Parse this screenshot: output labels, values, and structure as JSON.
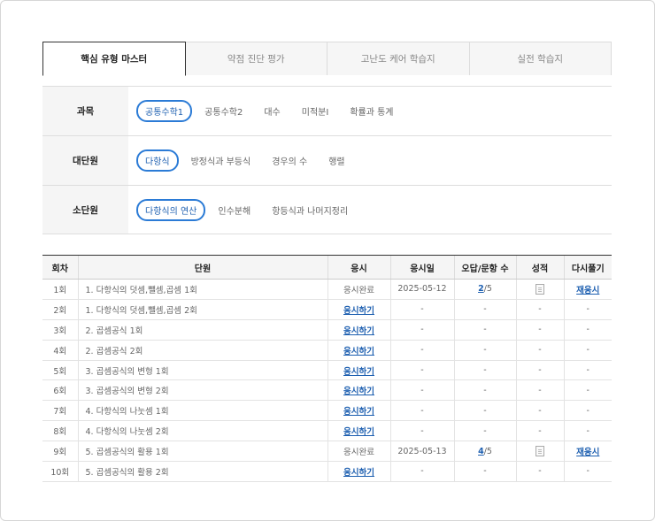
{
  "tabs": [
    {
      "label": "핵심 유형 마스터",
      "active": true
    },
    {
      "label": "약점 진단 평가",
      "active": false
    },
    {
      "label": "고난도 케어 학습지",
      "active": false
    },
    {
      "label": "실전 학습지",
      "active": false
    }
  ],
  "filters": {
    "subject": {
      "label": "과목",
      "options": [
        "공통수학1",
        "공통수학2",
        "대수",
        "미적분Ⅰ",
        "확률과 통계"
      ],
      "selected": "공통수학1"
    },
    "major_unit": {
      "label": "대단원",
      "options": [
        "다항식",
        "방정식과 부등식",
        "경우의 수",
        "행렬"
      ],
      "selected": "다항식"
    },
    "minor_unit": {
      "label": "소단원",
      "options": [
        "다항식의 연산",
        "인수분해",
        "항등식과 나머지정리"
      ],
      "selected": "다항식의 연산"
    }
  },
  "table": {
    "headers": [
      "회차",
      "단원",
      "응시",
      "응시일",
      "오답/문항 수",
      "성적",
      "다시풀기"
    ],
    "rows": [
      {
        "round": "1회",
        "unit": "1. 다항식의 덧셈,뺄셈,곱셈 1회",
        "status": "응시완료",
        "date": "2025-05-12",
        "wrong": "2",
        "total": "/5",
        "score": "doc",
        "retry": "재응시"
      },
      {
        "round": "2회",
        "unit": "1. 다항식의 덧셈,뺄셈,곱셈 2회",
        "status": "응시하기",
        "date": "-",
        "wrong": "-",
        "total": "",
        "score": "-",
        "retry": "-"
      },
      {
        "round": "3회",
        "unit": "2. 곱셈공식 1회",
        "status": "응시하기",
        "date": "-",
        "wrong": "-",
        "total": "",
        "score": "-",
        "retry": "-"
      },
      {
        "round": "4회",
        "unit": "2. 곱셈공식 2회",
        "status": "응시하기",
        "date": "-",
        "wrong": "-",
        "total": "",
        "score": "-",
        "retry": "-"
      },
      {
        "round": "5회",
        "unit": "3. 곱셈공식의 변형 1회",
        "status": "응시하기",
        "date": "-",
        "wrong": "-",
        "total": "",
        "score": "-",
        "retry": "-"
      },
      {
        "round": "6회",
        "unit": "3. 곱셈공식의 변형 2회",
        "status": "응시하기",
        "date": "-",
        "wrong": "-",
        "total": "",
        "score": "-",
        "retry": "-"
      },
      {
        "round": "7회",
        "unit": "4. 다항식의 나눗셈 1회",
        "status": "응시하기",
        "date": "-",
        "wrong": "-",
        "total": "",
        "score": "-",
        "retry": "-"
      },
      {
        "round": "8회",
        "unit": "4. 다항식의 나눗셈 2회",
        "status": "응시하기",
        "date": "-",
        "wrong": "-",
        "total": "",
        "score": "-",
        "retry": "-"
      },
      {
        "round": "9회",
        "unit": "5. 곱셈공식의 활용 1회",
        "status": "응시완료",
        "date": "2025-05-13",
        "wrong": "4",
        "total": "/5",
        "score": "doc",
        "retry": "재응시"
      },
      {
        "round": "10회",
        "unit": "5. 곱셈공식의 활용 2회",
        "status": "응시하기",
        "date": "-",
        "wrong": "-",
        "total": "",
        "score": "-",
        "retry": "-"
      }
    ]
  }
}
